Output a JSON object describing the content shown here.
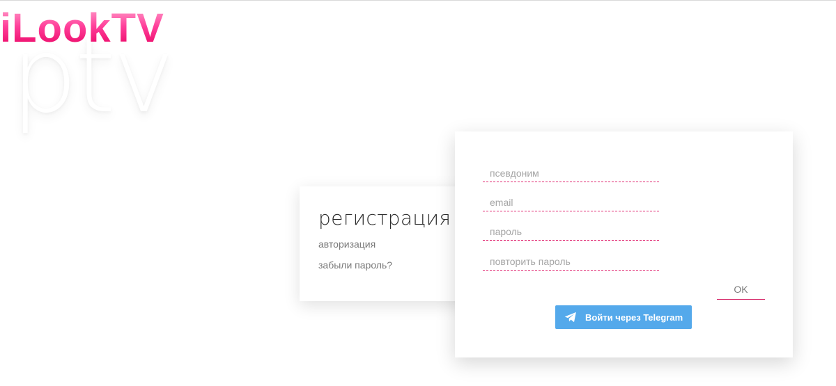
{
  "app": {
    "logo_text": "iLookTV",
    "logo_watermark": "ptv"
  },
  "side_menu": {
    "title": "регистрация",
    "links": [
      {
        "label": "авторизация"
      },
      {
        "label": "забыли пароль?"
      }
    ]
  },
  "form": {
    "fields": [
      {
        "placeholder": "псевдоним",
        "value": ""
      },
      {
        "placeholder": "email",
        "value": ""
      },
      {
        "placeholder": "пароль",
        "value": ""
      },
      {
        "placeholder": "повторить пароль",
        "value": ""
      }
    ],
    "ok_label": "OK",
    "telegram_label": "Войти через Telegram",
    "telegram_icon": "telegram-icon"
  },
  "colors": {
    "accent": "#e0256f",
    "telegram": "#54a9eb"
  }
}
